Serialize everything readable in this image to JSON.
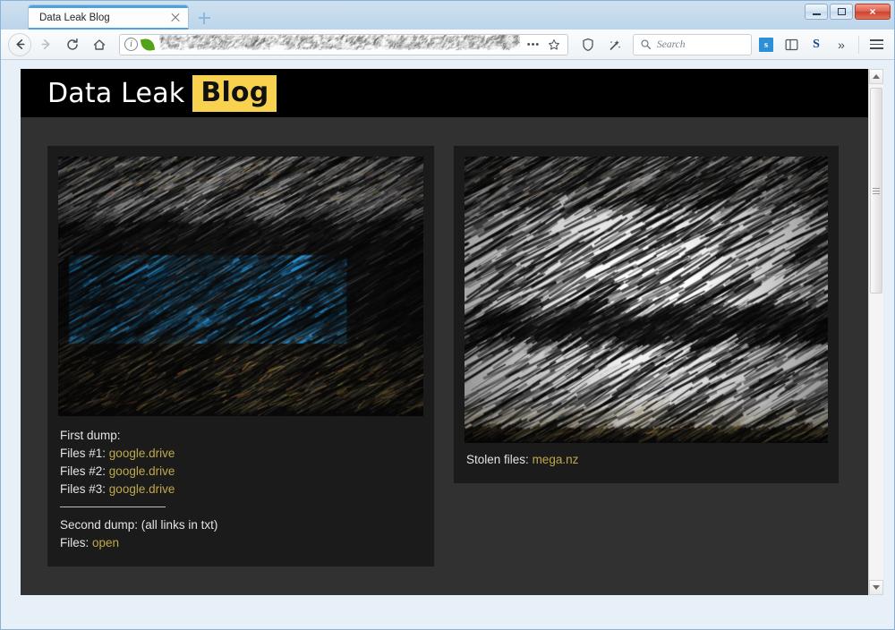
{
  "window": {
    "minimize_label": "Minimize",
    "maximize_label": "Maximize",
    "close_label": "×"
  },
  "browser": {
    "tab": {
      "title": "Data Leak Blog",
      "close_label": "",
      "newtab_label": ""
    },
    "nav": {
      "back_label": "←",
      "forward_label": "→",
      "reload_label": "⟳",
      "home_label": "⌂"
    },
    "urlbar": {
      "value": "",
      "redacted": true,
      "identity_icon": "i",
      "more_label": "•••",
      "bookmark_label": "☆",
      "shield_label": "shield",
      "pocket_label": "pocket"
    },
    "search": {
      "placeholder": "Search",
      "value": ""
    },
    "extensions": [
      {
        "name": "sync-badge",
        "label": "s"
      },
      {
        "name": "sidebar",
        "label": ""
      },
      {
        "name": "scribd",
        "label": "S"
      },
      {
        "name": "overflow",
        "label": "»"
      }
    ],
    "menu_label": "☰"
  },
  "site": {
    "header": {
      "title_plain": "Data Leak",
      "title_highlight": "Blog",
      "highlight_color": "#f8d24f",
      "background": "#000000"
    },
    "page_background": "#313131",
    "card_background": "#1b1b1b",
    "link_color": "#bfa84b"
  },
  "posts": [
    {
      "name": "post-card-left",
      "thumbnail": {
        "alt": "redacted-logo-blue",
        "redaction": "scribble",
        "accent_color": "#1f8fd6",
        "background": "#0b0b0b"
      },
      "lines": [
        {
          "type": "text",
          "text": "First dump:"
        },
        {
          "type": "link-row",
          "label": "Files #1:",
          "link": "google.drive"
        },
        {
          "type": "link-row",
          "label": "Files #2:",
          "link": "google.drive"
        },
        {
          "type": "link-row",
          "label": "Files #3:",
          "link": "google.drive"
        },
        {
          "type": "divider"
        },
        {
          "type": "text",
          "text": "Second dump: (all links in txt)"
        },
        {
          "type": "link-row",
          "label": "Files:",
          "link": "open"
        }
      ]
    },
    {
      "name": "post-card-right",
      "thumbnail": {
        "alt": "redacted-logo-white",
        "redaction": "scribble",
        "accent_color": "#f2f2f2",
        "background": "#0b0b0b"
      },
      "lines": [
        {
          "type": "link-row",
          "label": "Stolen files:",
          "link": "mega.nz"
        }
      ]
    }
  ],
  "scrollbar": {
    "up_label": "▲",
    "down_label": "▼",
    "thumb_label": "scroll-thumb"
  }
}
